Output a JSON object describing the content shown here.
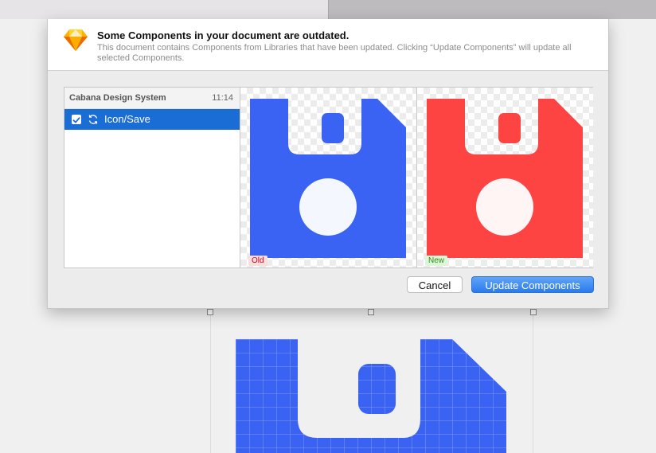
{
  "dialog": {
    "title": "Some Components in your document are outdated.",
    "description": "This document contains Components from Libraries that have been updated. Clicking “Update Components” will update all selected Components.",
    "list": {
      "library_name": "Cabana Design System",
      "library_time": "11:14",
      "items": [
        {
          "label": "Icon/Save",
          "checked": true,
          "selected": true
        }
      ]
    },
    "preview": {
      "old_tag": "Old",
      "new_tag": "New",
      "old_color": "#3b63f3",
      "new_color": "#fe4343"
    },
    "buttons": {
      "cancel_label": "Cancel",
      "update_label": "Update Components"
    }
  },
  "icons": {
    "app": "sketch-diamond-icon",
    "sync": "sync-arrows-icon",
    "check": "checkmark-icon",
    "component": "floppy-disk-save-icon"
  },
  "canvas": {
    "icon_color": "#3b63f3"
  }
}
